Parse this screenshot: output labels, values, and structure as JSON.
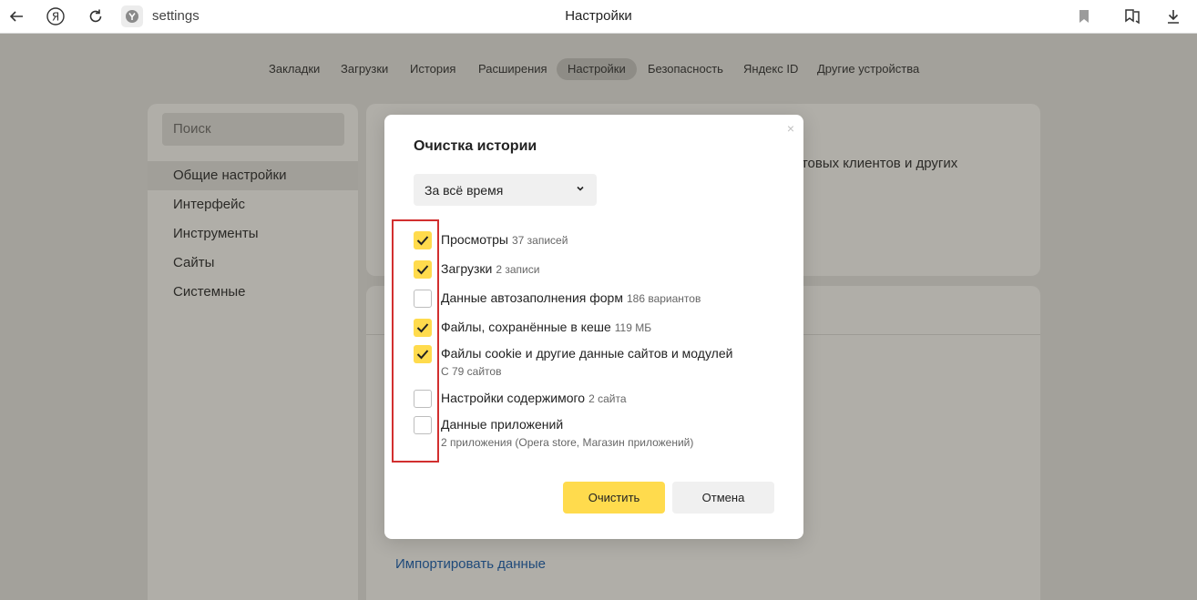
{
  "browser": {
    "address": "settings",
    "page_title": "Настройки",
    "icons": [
      "back-icon",
      "yandex-logo-icon",
      "reload-icon",
      "site-badge-icon",
      "bookmark-icon",
      "collections-icon",
      "download-icon"
    ]
  },
  "nav": {
    "tabs": [
      {
        "label": "Закладки",
        "active": false
      },
      {
        "label": "Загрузки",
        "active": false
      },
      {
        "label": "История",
        "active": false
      },
      {
        "label": "Расширения",
        "active": false
      },
      {
        "label": "Настройки",
        "active": true
      },
      {
        "label": "Безопасность",
        "active": false
      },
      {
        "label": "Яндекс ID",
        "active": false
      },
      {
        "label": "Другие устройства",
        "active": false
      }
    ]
  },
  "sidebar": {
    "search_placeholder": "Поиск",
    "items": [
      {
        "label": "Общие настройки",
        "active": true
      },
      {
        "label": "Интерфейс",
        "active": false
      },
      {
        "label": "Инструменты",
        "active": false
      },
      {
        "label": "Сайты",
        "active": false
      },
      {
        "label": "Системные",
        "active": false
      }
    ]
  },
  "background": {
    "card_text": "чтовых клиентов и других",
    "import_link": "Импортировать данные"
  },
  "dialog": {
    "title": "Очистка истории",
    "period": "За всё время",
    "options": [
      {
        "label": "Просмотры",
        "count": "37 записей",
        "checked": true
      },
      {
        "label": "Загрузки",
        "count": "2 записи",
        "checked": true
      },
      {
        "label": "Данные автозаполнения форм",
        "count": "186 вариантов",
        "checked": false
      },
      {
        "label": "Файлы, сохранённые в кеше",
        "count": "119 МБ",
        "checked": true
      },
      {
        "label": "Файлы cookie и другие данные сайтов и модулей",
        "sub": "С 79 сайтов",
        "checked": true
      },
      {
        "label": "Настройки содержимого",
        "count": "2 сайта",
        "checked": false
      },
      {
        "label": "Данные приложений",
        "sub": "2 приложения (Opera store, Магазин приложений)",
        "checked": false
      }
    ],
    "clear_button": "Очистить",
    "cancel_button": "Отмена"
  },
  "colors": {
    "accent": "#ffdb4d",
    "highlight": "#d22f2f",
    "link": "#1f4a7a"
  }
}
